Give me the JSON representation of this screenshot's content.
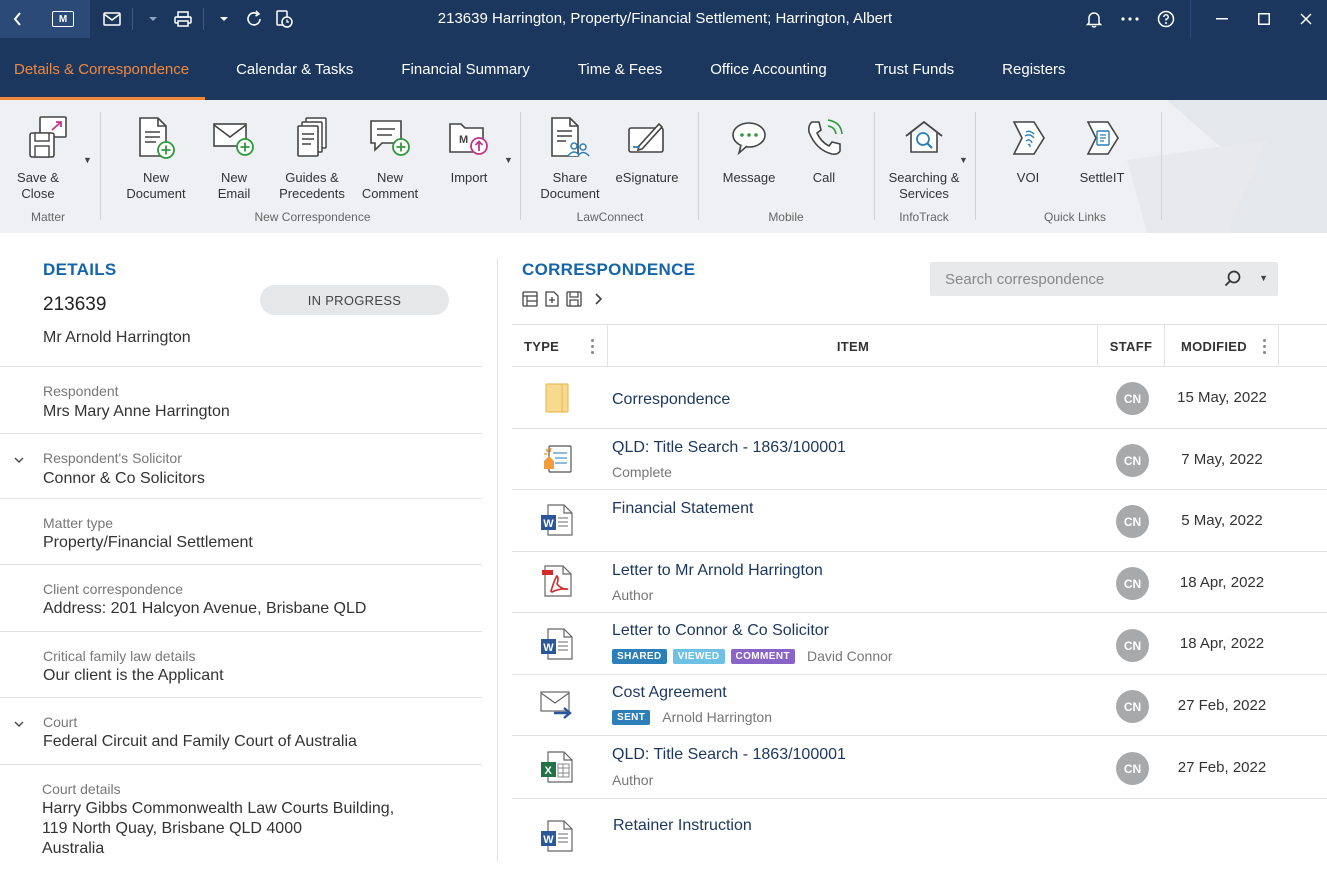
{
  "window": {
    "title": "213639 Harrington, Property/Financial Settlement; Harrington, Albert",
    "logo_letter": "M"
  },
  "nav": {
    "tabs": [
      {
        "label": "Details & Correspondence",
        "active": true
      },
      {
        "label": "Calendar & Tasks"
      },
      {
        "label": "Financial Summary"
      },
      {
        "label": "Time & Fees"
      },
      {
        "label": "Office Accounting"
      },
      {
        "label": "Trust Funds"
      },
      {
        "label": "Registers"
      }
    ]
  },
  "ribbon": {
    "save_close": "Save &\nClose",
    "new_document": "New\nDocument",
    "new_email": "New\nEmail",
    "guides": "Guides &\nPrecedents",
    "new_comment": "New\nComment",
    "import": "Import",
    "share_document": "Share\nDocument",
    "esignature": "eSignature",
    "message": "Message",
    "call": "Call",
    "searching": "Searching &\nServices",
    "voi": "VOI",
    "settleit": "SettleIT",
    "groups": {
      "matter": "Matter",
      "new_correspondence": "New Correspondence",
      "lawconnect": "LawConnect",
      "mobile": "Mobile",
      "infotrack": "InfoTrack",
      "quick_links": "Quick Links"
    }
  },
  "details": {
    "heading": "DETAILS",
    "matter_number": "213639",
    "client_name": "Mr Arnold Harrington",
    "status": "IN PROGRESS",
    "respondent_label": "Respondent",
    "respondent_value": "Mrs Mary Anne Harrington",
    "solicitor_label": "Respondent's Solicitor",
    "solicitor_value": "Connor & Co Solicitors",
    "matter_type_label": "Matter type",
    "matter_type_value": "Property/Financial Settlement",
    "client_corr_label": "Client correspondence",
    "client_corr_value": "Address: 201 Halcyon Avenue, Brisbane QLD",
    "critical_label": "Critical family law details",
    "critical_value": "Our client is the Applicant",
    "court_label": "Court",
    "court_value": "Federal Circuit and Family Court of Australia",
    "court_details_label": "Court details",
    "court_details_line1": "Harry Gibbs Commonwealth Law Courts Building,",
    "court_details_line2": "119 North Quay, Brisbane QLD 4000",
    "court_details_line3": "Australia"
  },
  "correspondence": {
    "heading": "CORRESPONDENCE",
    "search_placeholder": "Search correspondence",
    "columns": {
      "type": "TYPE",
      "item": "ITEM",
      "staff": "STAFF",
      "modified": "MODIFIED"
    },
    "rows": [
      {
        "icon": "folder-icon",
        "title": "Correspondence",
        "sub": "",
        "staff": "CN",
        "modified": "15 May, 2022"
      },
      {
        "icon": "title-search-icon",
        "title": "QLD: Title Search - 1863/100001",
        "sub": "Complete",
        "staff": "CN",
        "modified": "7 May, 2022"
      },
      {
        "icon": "word-doc-icon",
        "title": "Financial Statement",
        "sub": "",
        "staff": "CN",
        "modified": "5 May, 2022"
      },
      {
        "icon": "pdf-icon",
        "title": "Letter to Mr Arnold Harrington",
        "sub": "Author",
        "staff": "CN",
        "modified": "18 Apr, 2022"
      },
      {
        "icon": "word-doc-icon",
        "title": "Letter to Connor & Co Solicitor",
        "badges": [
          "SHARED",
          "VIEWED",
          "COMMENT"
        ],
        "sub": "David Connor",
        "staff": "CN",
        "modified": "18 Apr, 2022"
      },
      {
        "icon": "sent-email-icon",
        "title": "Cost Agreement",
        "badges": [
          "SENT"
        ],
        "sub": "Arnold Harrington",
        "staff": "CN",
        "modified": "27 Feb, 2022"
      },
      {
        "icon": "excel-doc-icon",
        "title": "QLD: Title Search - 1863/100001",
        "sub": "Author",
        "staff": "CN",
        "modified": "27 Feb, 2022"
      },
      {
        "icon": "word-doc-icon",
        "title": "Retainer Instruction",
        "sub": "",
        "staff": "",
        "modified": ""
      }
    ]
  },
  "colors": {
    "navy": "#1c375e",
    "accent_orange": "#f0883c",
    "heading_blue": "#1565a8"
  }
}
